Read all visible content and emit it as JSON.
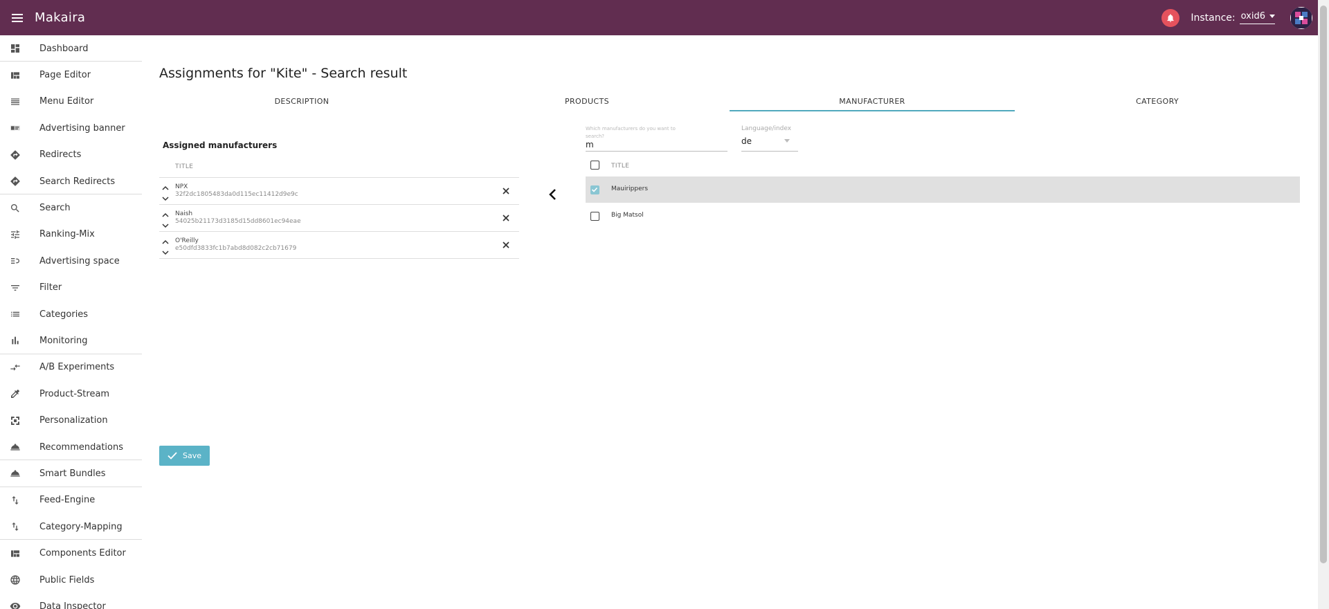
{
  "app": {
    "title": "Makaira"
  },
  "header": {
    "instance_label": "Instance:",
    "instance_value": "oxid6"
  },
  "sidebar": {
    "items": [
      {
        "label": "Dashboard",
        "icon": "dashboard-icon"
      },
      {
        "label": "Page Editor",
        "icon": "page-editor-icon"
      },
      {
        "label": "Menu Editor",
        "icon": "menu-editor-icon"
      },
      {
        "label": "Advertising banner",
        "icon": "banner-icon"
      },
      {
        "label": "Redirects",
        "icon": "redirect-icon"
      },
      {
        "label": "Search Redirects",
        "icon": "search-redirect-icon"
      },
      {
        "label": "Search",
        "icon": "search-icon"
      },
      {
        "label": "Ranking-Mix",
        "icon": "ranking-mix-icon"
      },
      {
        "label": "Advertising space",
        "icon": "advertising-space-icon"
      },
      {
        "label": "Filter",
        "icon": "filter-icon"
      },
      {
        "label": "Categories",
        "icon": "categories-icon"
      },
      {
        "label": "Monitoring",
        "icon": "monitoring-icon"
      },
      {
        "label": "A/B Experiments",
        "icon": "ab-experiments-icon"
      },
      {
        "label": "Product-Stream",
        "icon": "product-stream-icon"
      },
      {
        "label": "Personalization",
        "icon": "personalization-icon"
      },
      {
        "label": "Recommendations",
        "icon": "recommendations-icon"
      },
      {
        "label": "Smart Bundles",
        "icon": "smart-bundles-icon"
      },
      {
        "label": "Feed-Engine",
        "icon": "feed-engine-icon"
      },
      {
        "label": "Category-Mapping",
        "icon": "category-mapping-icon"
      },
      {
        "label": "Components Editor",
        "icon": "components-editor-icon"
      },
      {
        "label": "Public Fields",
        "icon": "globe-icon"
      },
      {
        "label": "Data Inspector",
        "icon": "eye-icon"
      }
    ]
  },
  "page": {
    "title": "Assignments for \"Kite\" - Search result"
  },
  "tabs": [
    {
      "label": "DESCRIPTION",
      "active": false
    },
    {
      "label": "PRODUCTS",
      "active": false
    },
    {
      "label": "MANUFACTURER",
      "active": true
    },
    {
      "label": "CATEGORY",
      "active": false
    }
  ],
  "assigned": {
    "title": "Assigned manufacturers",
    "column_title": "TITLE",
    "rows": [
      {
        "title": "NPX",
        "id": "32f2dc1805483da0d115ec11412d9e9c"
      },
      {
        "title": "Naish",
        "id": "54025b21173d3185d15dd8601ec94eae"
      },
      {
        "title": "O'Reilly",
        "id": "e50dfd3833fc1b7abd8d082c2cb71679"
      }
    ]
  },
  "search": {
    "placeholder": "Which manufacturers do you want to search?",
    "value": "m"
  },
  "language": {
    "label": "Language/index",
    "value": "de"
  },
  "results": {
    "column_title": "TITLE",
    "rows": [
      {
        "title": "Mauirippers",
        "checked": true
      },
      {
        "title": "Big Matsol",
        "checked": false
      }
    ]
  },
  "actions": {
    "save_label": "Save"
  },
  "colors": {
    "header_bg": "#612d50",
    "accent": "#5bb3c7",
    "notification": "#e5525d"
  }
}
